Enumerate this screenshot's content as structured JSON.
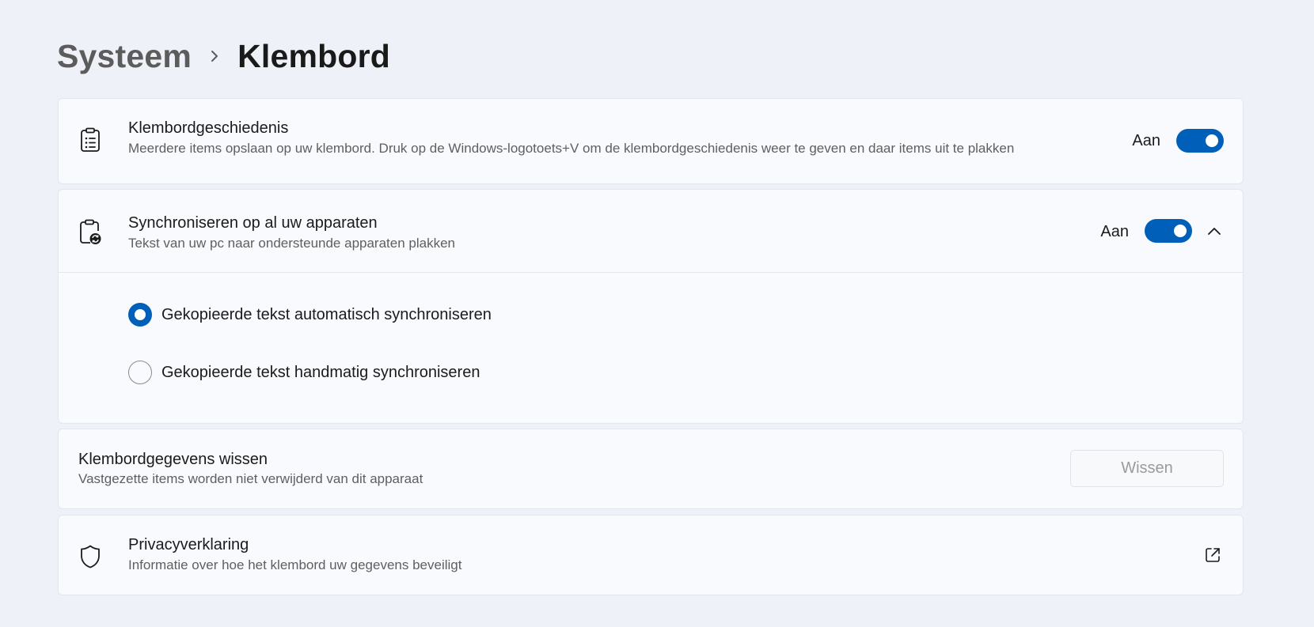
{
  "breadcrumb": {
    "parent": "Systeem",
    "current": "Klembord"
  },
  "history": {
    "icon": "clipboard-list-icon",
    "title": "Klembordgeschiedenis",
    "description": "Meerdere items opslaan op uw klembord. Druk op de Windows-logotoets+V om de klembordgeschiedenis weer te geven en daar items uit te plakken",
    "state_label": "Aan",
    "enabled": true
  },
  "sync": {
    "icon": "clipboard-sync-icon",
    "title": "Synchroniseren op al uw apparaten",
    "description": "Tekst van uw pc naar ondersteunde apparaten plakken",
    "state_label": "Aan",
    "enabled": true,
    "expanded": true,
    "options": [
      {
        "label": "Gekopieerde tekst automatisch synchroniseren",
        "selected": true
      },
      {
        "label": "Gekopieerde tekst handmatig synchroniseren",
        "selected": false
      }
    ]
  },
  "clear": {
    "title": "Klembordgegevens wissen",
    "description": "Vastgezette items worden niet verwijderd van dit apparaat",
    "button_label": "Wissen",
    "button_enabled": false
  },
  "privacy": {
    "icon": "shield-icon",
    "title": "Privacyverklaring",
    "description": "Informatie over hoe het klembord uw gegevens beveiligt",
    "link_icon": "external-link-icon"
  },
  "colors": {
    "accent": "#005fb8",
    "background": "#eef2f8",
    "card": "#f9fafd"
  }
}
